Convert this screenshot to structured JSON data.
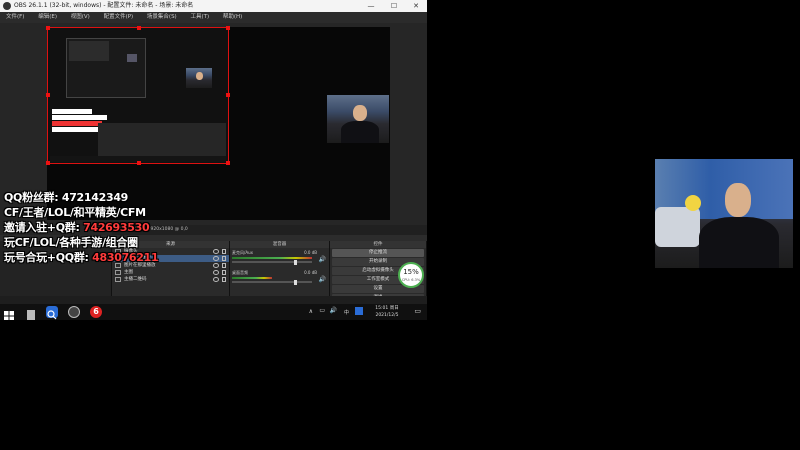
{
  "window": {
    "title": "OBS 26.1.1 (32-bit, windows) - 配置文件: 未命名 - 场景: 未命名",
    "controls": {
      "minimize": "—",
      "maximize": "☐",
      "close": "✕"
    }
  },
  "menu": [
    "文件(F)",
    "编辑(E)",
    "视图(V)",
    "配置文件(P)",
    "场景集合(S)",
    "工具(T)",
    "帮助(H)"
  ],
  "preview_toolbar": "显示器  显示器 1: 1920x1080 @ 0,0",
  "panels": {
    "scenes_left_label": "1920",
    "sources": {
      "header": "来源",
      "items": [
        "摄像头",
        "显示器采集 2",
        "图片在那里播放",
        "主图",
        "主播二维码"
      ],
      "selected_index": 1
    },
    "mixer": {
      "header": "混音器",
      "channels": [
        {
          "name": "麦克风/Aux",
          "db": "0.0 dB",
          "level": 0.65
        },
        {
          "name": "桌面音频",
          "db": "0.0 dB",
          "level": 0.45
        }
      ]
    },
    "controls": {
      "header": "控件",
      "buttons": [
        "停止推流",
        "开始录制",
        "启动虚拟摄像头",
        "工作室模式",
        "设置",
        "退出"
      ],
      "active_index": 0
    },
    "transition_tabs": [
      "混音器",
      "转场特效"
    ],
    "bottom_icons": "+ − ∧ ∨"
  },
  "cpu": {
    "percent": "15%",
    "label": "CPU: 6.3%"
  },
  "promo": [
    {
      "white": "QQ粉丝群: ",
      "red": "",
      "white2": "472142349"
    },
    {
      "white": "CF/王者/LOL/和平精英/CFM",
      "red": "",
      "white2": ""
    },
    {
      "white": "邀请入驻+Q群: ",
      "red": "742693530",
      "white2": ""
    },
    {
      "white": "玩CF/LOL/各种手游/组合圈",
      "red": "",
      "white2": ""
    },
    {
      "white": "玩号合玩+QQ群: ",
      "red": "483076211",
      "white2": ""
    }
  ],
  "taskbar": {
    "time": "15:01 周日",
    "date": "2021/12/5",
    "ime": "中",
    "notification": "▭"
  },
  "colors": {
    "selection": "#dd1111",
    "promo_red": "#ff3b3b",
    "accent": "#3d5c85"
  },
  "icons": [
    "windows-start-icon",
    "search-icon",
    "obs-icon",
    "app-six-icon",
    "eye-icon",
    "lock-icon",
    "gear-icon"
  ]
}
